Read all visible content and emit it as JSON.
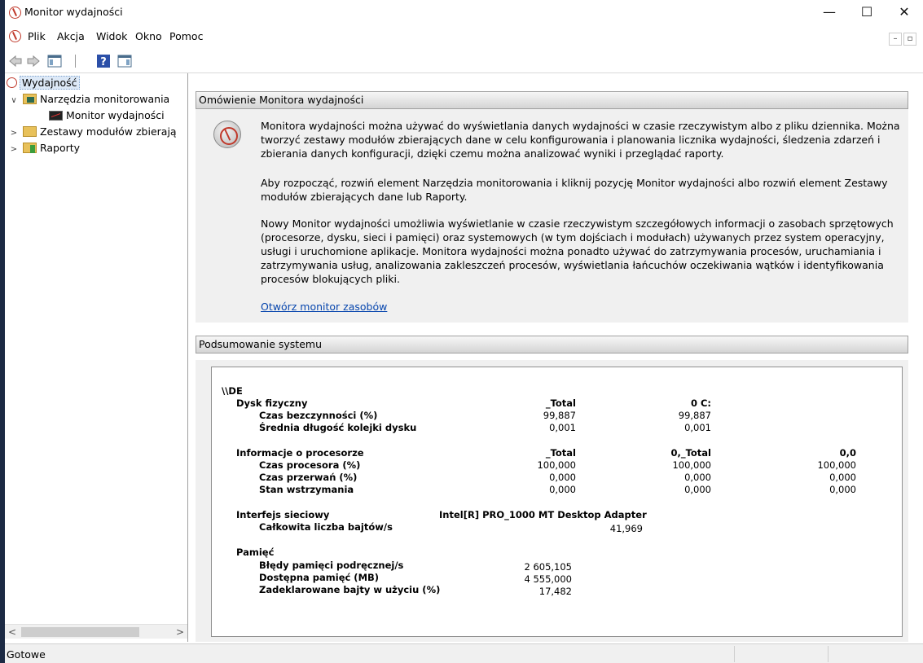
{
  "window": {
    "title": "Monitor wydajności",
    "minimize_glyph": "—",
    "maximize_glyph": "☐",
    "close_glyph": "✕"
  },
  "menu": {
    "items": [
      "Plik",
      "Akcja",
      "Widok",
      "Okno",
      "Pomoc"
    ],
    "mdi_minimize": "–",
    "mdi_restore": "▫"
  },
  "toolbar": {
    "icons": [
      "back-arrow-icon",
      "forward-arrow-icon",
      "show-hide-console-tree-icon",
      "help-icon",
      "show-hide-action-pane-icon"
    ]
  },
  "tree": {
    "items": [
      {
        "label": "Wydajność",
        "level": 0,
        "expander": "",
        "selected": true
      },
      {
        "label": "Narzędzia monitorowania",
        "level": 1,
        "expander": "∨"
      },
      {
        "label": "Monitor wydajności",
        "level": 2,
        "expander": ""
      },
      {
        "label": "Zestawy modułów zbierają",
        "level": 1,
        "expander": ">"
      },
      {
        "label": "Raporty",
        "level": 1,
        "expander": ">"
      }
    ],
    "scroll_left": "<",
    "scroll_right": ">"
  },
  "overview": {
    "header": "Omówienie Monitora wydajności",
    "paragraph1": "Monitora wydajności można używać do wyświetlania danych wydajności w czasie rzeczywistym albo z pliku dziennika. Można tworzyć zestawy modułów zbierających dane w celu konfigurowania i planowania licznika wydajności, śledzenia zdarzeń i zbierania danych konfiguracji, dzięki czemu można analizować wyniki i przeglądać raporty.",
    "paragraph2": "Aby rozpocząć, rozwiń element Narzędzia monitorowania i kliknij pozycję Monitor wydajności albo rozwiń element Zestawy modułów zbierających dane lub Raporty.",
    "paragraph3": "Nowy Monitor wydajności umożliwia wyświetlanie w czasie rzeczywistym szczegółowych informacji o zasobach sprzętowych (procesorze, dysku, sieci i pamięci) oraz systemowych (w tym dojściach i modułach) używanych przez system operacyjny, usługi i uruchomione aplikacje. Monitora wydajności można ponadto używać do zatrzymywania procesów, uruchamiania i zatrzymywania usług, analizowania zakleszczeń procesów, wyświetlania łańcuchów oczekiwania wątków i identyfikowania procesów blokujących pliki.",
    "link": "Otwórz monitor zasobów"
  },
  "summary": {
    "header": "Podsumowanie systemu",
    "machine": "\\\\DE",
    "disk": {
      "title": "Dysk fizyczny",
      "col1": "_Total",
      "col2": "0 C:",
      "rows": [
        {
          "label": "Czas bezczynności (%)",
          "v1": "99,887",
          "v2": "99,887"
        },
        {
          "label": "Średnia długość kolejki dysku",
          "v1": "0,001",
          "v2": "0,001"
        }
      ]
    },
    "cpu": {
      "title": "Informacje o procesorze",
      "col1": "_Total",
      "col2": "0,_Total",
      "col3": "0,0",
      "rows": [
        {
          "label": "Czas procesora (%)",
          "v1": "100,000",
          "v2": "100,000",
          "v3": "100,000"
        },
        {
          "label": "Czas przerwań (%)",
          "v1": "0,000",
          "v2": "0,000",
          "v3": "0,000"
        },
        {
          "label": "Stan wstrzymania",
          "v1": "0,000",
          "v2": "0,000",
          "v3": "0,000"
        }
      ]
    },
    "network": {
      "title": "Interfejs sieciowy",
      "adapter": "Intel[R] PRO_1000 MT Desktop Adapter",
      "rows": [
        {
          "label": "Całkowita liczba bajtów/s",
          "v1": "41,969"
        }
      ]
    },
    "memory": {
      "title": "Pamięć",
      "rows": [
        {
          "label": "Błędy pamięci podręcznej/s",
          "v1": "2 605,105"
        },
        {
          "label": "Dostępna pamięć (MB)",
          "v1": "4 555,000"
        },
        {
          "label": "Zadeklarowane bajty w użyciu (%)",
          "v1": "17,482"
        }
      ]
    }
  },
  "status": {
    "text": "Gotowe"
  }
}
